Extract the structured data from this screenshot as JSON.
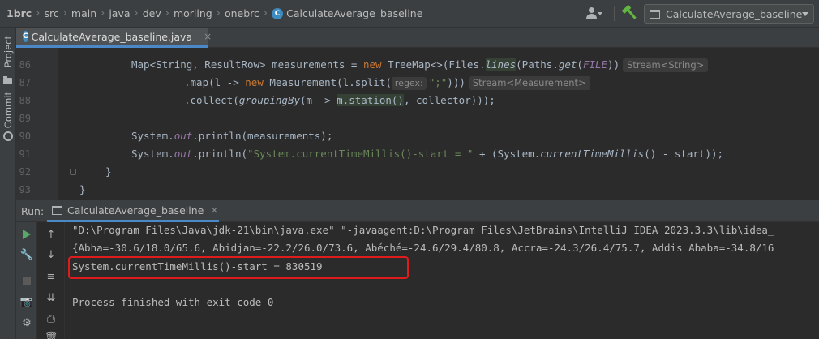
{
  "breadcrumbs": [
    "1brc",
    "src",
    "main",
    "java",
    "dev",
    "morling",
    "onebrc",
    "CalculateAverage_baseline"
  ],
  "run_config": "CalculateAverage_baseline",
  "tool_stripe": {
    "project": "Project",
    "commit": "Commit"
  },
  "editor_tab": {
    "label": "CalculateAverage_baseline.java",
    "close": "×"
  },
  "class_badge": "C",
  "code": {
    "l86": {
      "num": "86",
      "a": "Map<String, ResultRow> measurements = ",
      "new": "new",
      "b": " TreeMap<>(Files.",
      "lines": "lines",
      "c": "(Paths.",
      "get": "get",
      "d": "(",
      "file": "FILE",
      "e": "))",
      "hint": "Stream<String>"
    },
    "l87": {
      "num": "87",
      "a": ".map(l -> ",
      "new": "new",
      "b": " Measurement(l.split(",
      "param": "regex:",
      "str": "\";\"",
      "c": ")))",
      "hint": "Stream<Measurement>"
    },
    "l88": {
      "num": "88",
      "a": ".collect(",
      "grouping": "groupingBy",
      "b": "(m -> ",
      "station": "m.station()",
      "c": ", collector)));"
    },
    "l89": {
      "num": "89"
    },
    "l90": {
      "num": "90",
      "a": "System.",
      "out": "out",
      "b": ".println(measurements);"
    },
    "l91": {
      "num": "91",
      "a": "System.",
      "out": "out",
      "b": ".println(",
      "str": "\"System.currentTimeMillis()-start = \"",
      "c": " + (System.",
      "ctm": "currentTimeMillis",
      "d": "() - start));"
    },
    "l92": {
      "num": "92",
      "a": "}"
    },
    "l93": {
      "num": "93",
      "a": "}"
    }
  },
  "run_panel": {
    "title": "Run:",
    "tab_label": "CalculateAverage_baseline"
  },
  "console": {
    "cmd": "\"D:\\Program Files\\Java\\jdk-21\\bin\\java.exe\" \"-javaagent:D:\\Program Files\\JetBrains\\IntelliJ IDEA 2023.3.3\\lib\\idea_",
    "output": "{Abha=-30.6/18.0/65.6, Abidjan=-22.2/26.0/73.6, Abéché=-24.6/29.4/80.8, Accra=-24.3/26.4/75.7, Addis Ababa=-34.8/16",
    "result": "System.currentTimeMillis()-start = 830519",
    "exit": "Process finished with exit code 0"
  },
  "colors": {
    "highlight_box": "#e01b1b",
    "accent": "#4a88c7",
    "run_green": "#59a869"
  }
}
